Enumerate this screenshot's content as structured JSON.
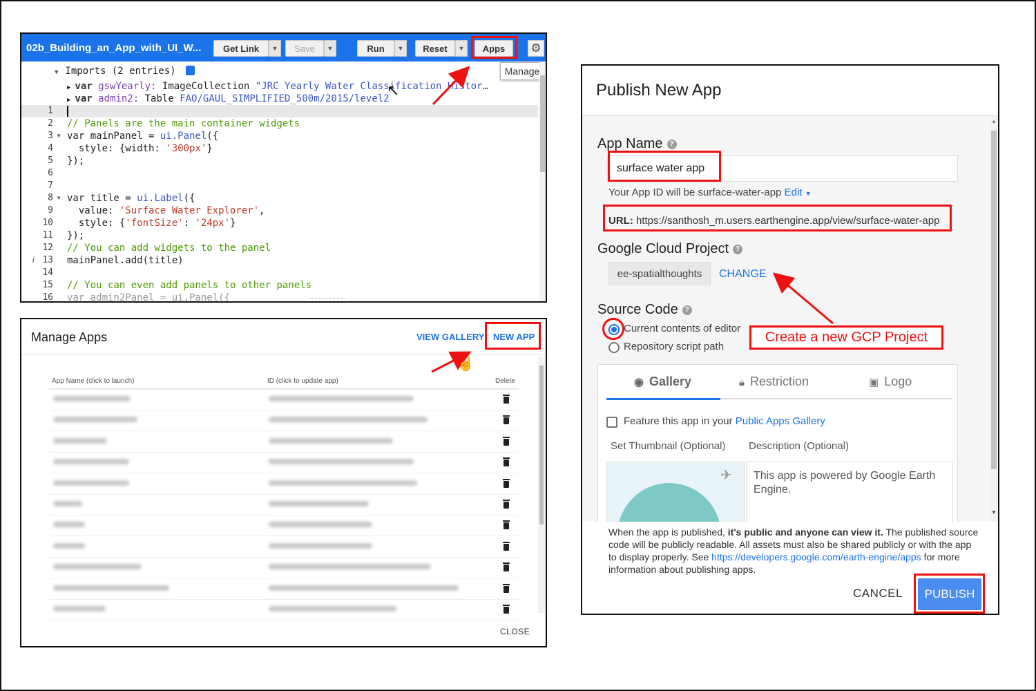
{
  "editor": {
    "script_title": "02b_Building_an_App_with_UI_W...",
    "toolbar": {
      "get_link": "Get Link",
      "save": "Save",
      "run": "Run",
      "reset": "Reset",
      "apps": "Apps",
      "tooltip": "Manage"
    },
    "imports": {
      "header": "Imports (2 entries)",
      "row1_kw": "var",
      "row1_name": "gswYearly:",
      "row1_type": "ImageCollection",
      "row1_value": "\"JRC Yearly Water Classification Histor…",
      "row2_kw": "var",
      "row2_name": "admin2:",
      "row2_type": "Table",
      "row2_value": "FAO/GAUL_SIMPLIFIED_500m/2015/level2"
    },
    "line_numbers": [
      "1",
      "2",
      "3",
      "4",
      "5",
      "6",
      "7",
      "8",
      "9",
      "10",
      "11",
      "12",
      "13",
      "14",
      "15",
      "16"
    ],
    "code": {
      "l2": "// Panels are the main container widgets",
      "l3a": "var mainPanel = ",
      "l3b": "ui.Panel",
      "l3c": "({",
      "l4a": "  style: {width: ",
      "l4b": "'300px'",
      "l4c": "}",
      "l5": "});",
      "l8a": "var title = ",
      "l8b": "ui.Label",
      "l8c": "({",
      "l9a": "  value: ",
      "l9b": "'Surface Water Explorer'",
      "l9c": ",",
      "l10a": "  style: {",
      "l10b": "'fontSize'",
      "l10c": ": ",
      "l10d": "'24px'",
      "l10e": "}",
      "l11": "});",
      "l12": "// You can add widgets to the panel",
      "l13": "mainPanel.add(title)",
      "l15": "// You can even add panels to other panels",
      "l16": "var admin2Panel = ui.Panel({"
    }
  },
  "manage_apps": {
    "title": "Manage Apps",
    "view_gallery": "VIEW GALLERY",
    "new_app": "NEW APP",
    "columns": {
      "name": "App Name (click to launch)",
      "id": "ID (click to update app)",
      "delete": "Delete"
    },
    "close": "CLOSE"
  },
  "publish": {
    "title": "Publish New App",
    "app_name_label": "App Name",
    "app_name_value": "surface water app",
    "app_id_prefix": "Your App ID will be surface-water-app",
    "edit": "Edit",
    "url_label": "URL:",
    "url_value": "https://santhosh_m.users.earthengine.app/view/surface-water-app",
    "gcp_label": "Google Cloud Project",
    "gcp_value": "ee-spatialthoughts",
    "change": "CHANGE",
    "source_label": "Source Code",
    "source_opt1": "Current contents of editor",
    "source_opt2": "Repository script path",
    "tabs": [
      "Gallery",
      "Restriction",
      "Logo"
    ],
    "feature_prefix": "Feature this app in your",
    "feature_link": "Public Apps Gallery",
    "thumb_label": "Set Thumbnail (Optional)",
    "desc_label": "Description (Optional)",
    "desc_value": "This app is powered by Google Earth Engine.",
    "notice_1": "When the app is published, ",
    "notice_bold": "it's public and anyone can view it.",
    "notice_2": " The published source code will be publicly readable. All assets must also be shared publicly or with the app to display properly. See ",
    "notice_link": "https://developers.google.com/earth-engine/apps",
    "notice_3": " for more information about publishing apps.",
    "cancel": "CANCEL",
    "publish": "PUBLISH"
  },
  "annotation": {
    "callout": "Create a new GCP Project"
  },
  "colors": {
    "accent_blue": "#1a73e8",
    "annotation_red": "#e11111",
    "toolbar_blue": "#1a73e8"
  }
}
